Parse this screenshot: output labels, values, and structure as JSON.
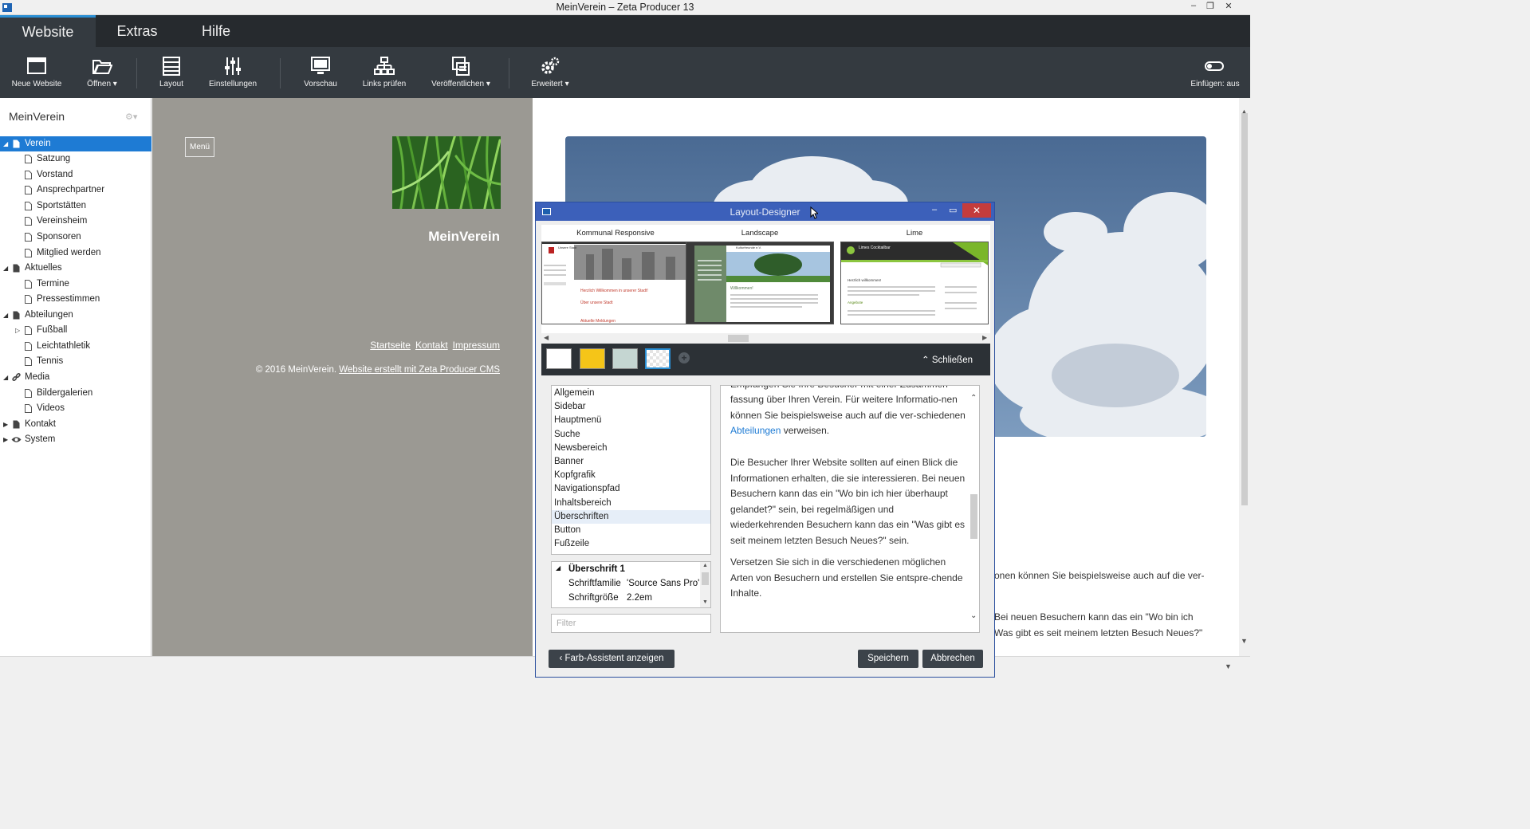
{
  "window": {
    "title": "MeinVerein – Zeta Producer 13",
    "min": "–",
    "max": "❐",
    "close": "✕"
  },
  "menu": {
    "tabs": [
      {
        "label": "Website"
      },
      {
        "label": "Extras"
      },
      {
        "label": "Hilfe"
      }
    ]
  },
  "toolbar": {
    "new_site": "Neue Website",
    "open": "Öffnen ▾",
    "layout": "Layout",
    "settings": "Einstellungen",
    "preview": "Vorschau",
    "check_links": "Links prüfen",
    "publish": "Veröffentlichen ▾",
    "advanced": "Erweitert ▾",
    "insert": "Einfügen: aus"
  },
  "sidebar": {
    "title": "MeinVerein",
    "items": [
      {
        "label": "Verein"
      },
      {
        "label": "Satzung"
      },
      {
        "label": "Vorstand"
      },
      {
        "label": "Ansprechpartner"
      },
      {
        "label": "Sportstätten"
      },
      {
        "label": "Vereinsheim"
      },
      {
        "label": "Sponsoren"
      },
      {
        "label": "Mitglied werden"
      },
      {
        "label": "Aktuelles"
      },
      {
        "label": "Termine"
      },
      {
        "label": "Pressestimmen"
      },
      {
        "label": "Abteilungen"
      },
      {
        "label": "Fußball"
      },
      {
        "label": "Leichtathletik"
      },
      {
        "label": "Tennis"
      },
      {
        "label": "Media"
      },
      {
        "label": "Bildergalerien"
      },
      {
        "label": "Videos"
      },
      {
        "label": "Kontakt"
      },
      {
        "label": "System"
      }
    ]
  },
  "preview": {
    "menu_button": "Menü",
    "brand": "MeinVerein",
    "footer_links": [
      "Startseite",
      "Kontakt",
      "Impressum"
    ],
    "copyright": "© 2016 MeinVerein.",
    "credit": "Website erstellt mit Zeta Producer CMS",
    "text1": "onen können Sie beispielsweise auch auf die ver-",
    "text2": "Bei neuen Besuchern kann das ein \"Wo bin ich",
    "text3": "Was gibt es seit meinem letzten Besuch Neues?\""
  },
  "dialog": {
    "title": "Layout-Designer",
    "layouts": [
      {
        "name": "Kommunal Responsive",
        "thumb_title": "Unsere Stadt",
        "thumb_h1": "Herzlich Willkommen in unserer Stadt!",
        "thumb_h2": "Über unsere Stadt",
        "thumb_h3": "Aktuelle Meldungen"
      },
      {
        "name": "Landscape",
        "thumb_title": "Kulturfreunde e.V.",
        "thumb_h1": "Willkommen!"
      },
      {
        "name": "Lime",
        "thumb_title": "Limes Cocktailbar",
        "thumb_h1": "Herzlich willkommen!",
        "thumb_h2": "Angebote"
      }
    ],
    "swatch_colors": [
      "#ffffff",
      "#f5c518",
      "#c5d6d2"
    ],
    "close_label": "Schließen",
    "categories": [
      {
        "label": "Allgemein"
      },
      {
        "label": "Sidebar"
      },
      {
        "label": "Hauptmenü"
      },
      {
        "label": "Suche"
      },
      {
        "label": "Newsbereich"
      },
      {
        "label": "Banner"
      },
      {
        "label": "Kopfgrafik"
      },
      {
        "label": "Navigationspfad"
      },
      {
        "label": "Inhaltsbereich"
      },
      {
        "label": "Überschriften"
      },
      {
        "label": "Button"
      },
      {
        "label": "Fußzeile"
      }
    ],
    "props": {
      "group": "Überschrift 1",
      "rows": [
        {
          "key": "Schriftfamilie",
          "value": "'Source Sans Pro',"
        },
        {
          "key": "Schriftgröße",
          "value": "2.2em"
        }
      ]
    },
    "filter_placeholder": "Filter",
    "text": {
      "p0": "Empfangen Sie Ihre Besucher mit einer Zusammen-",
      "p1a": "fassung über Ihren Verein. Für weitere Informatio-nen können Sie beispielsweise auch auf die ver-schiedenen ",
      "p1link": "Abteilungen",
      "p1b": " verweisen.",
      "p2": "Die Besucher Ihrer Website sollten auf einen Blick die Informationen erhalten, die sie interessieren. Bei neuen Besuchern kann das ein \"Wo bin ich hier überhaupt gelandet?\" sein, bei regelmäßigen und wiederkehrenden Besuchern kann das ein \"Was gibt es seit meinem letzten Besuch Neues?\" sein.",
      "p3": "Versetzen Sie sich in die verschiedenen möglichen Arten von Besuchern und erstellen Sie entspre-chende Inhalte."
    },
    "buttons": {
      "color_assistant": "Farb-Assistent anzeigen",
      "save": "Speichern",
      "cancel": "Abbrechen"
    }
  }
}
